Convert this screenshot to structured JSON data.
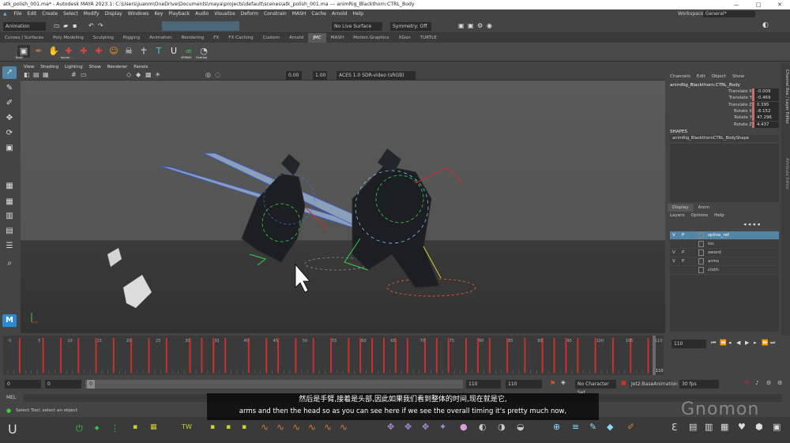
{
  "title_bar": {
    "text": "atk_polish_001.ma* - Autodesk MAYA 2023.1: C:\\Users\\juanm\\OneDrive\\Documents\\maya\\projects\\default\\scenes\\atk_polish_001.ma  ---  animRig_Blackthorn:CTRL_Body",
    "minimize": "—",
    "maximize": "□",
    "close": "✕"
  },
  "menu_bar": {
    "items": [
      "File",
      "Edit",
      "Create",
      "Select",
      "Modify",
      "Display",
      "Windows",
      "Key",
      "Playback",
      "Audio",
      "Visualize",
      "Deform",
      "Constrain",
      "MASH",
      "Cache",
      "Arnold",
      "Help"
    ],
    "workspace_label": "Workspace:",
    "workspace_value": "General*"
  },
  "status_line": {
    "menu_set": "Animation",
    "live_surface": "No Live Surface",
    "symmetry": "Symmetry: Off"
  },
  "shelf_tabs": [
    "Curves / Surfaces",
    "Poly Modeling",
    "Sculpting",
    "Rigging",
    "Animation",
    "Rendering",
    "FX",
    "FX Caching",
    "Custom",
    "Arnold",
    "JMC",
    "MASH",
    "Motion Graphics",
    "XGen",
    "TURTLE"
  ],
  "shelf_tab_active": "JMC",
  "shelf_icons": [
    {
      "icon": "bake-icon",
      "label": "BAKE",
      "color": "#333"
    },
    {
      "icon": "feather-icon",
      "label": "",
      "color": "#4a4a4a"
    },
    {
      "icon": "hand-icon",
      "label": "",
      "color": "#4a4a4a"
    },
    {
      "icon": "red-character-icon",
      "label": "bonier",
      "color": "#4a4a4a"
    },
    {
      "icon": "red-character-icon-2",
      "label": "",
      "color": "#4a4a4a"
    },
    {
      "icon": "red-character-icon-3",
      "label": "",
      "color": "#4a4a4a"
    },
    {
      "icon": "smiley-icon",
      "label": "",
      "color": "#4a4a4a"
    },
    {
      "icon": "skull-icon",
      "label": "",
      "color": "#4a4a4a"
    },
    {
      "icon": "stick-figure-icon",
      "label": "",
      "color": "#4a4a4a"
    },
    {
      "icon": "t-pose-icon",
      "label": "",
      "color": "#4a4a4a"
    },
    {
      "icon": "magnet-icon",
      "label": "",
      "color": "#4a4a4a"
    },
    {
      "icon": "spring-icon",
      "label": "SPRING",
      "color": "#4a4a4a"
    },
    {
      "icon": "overlap-icon",
      "label": "Overlap",
      "color": "#4a4a4a"
    }
  ],
  "viewport": {
    "menus": [
      "View",
      "Shading",
      "Lighting",
      "Show",
      "Renderer",
      "Panels"
    ],
    "exposure": "0.00",
    "gamma": "1.00",
    "color_space": "ACES 1.0 SDR-video (sRGB)"
  },
  "channel_box": {
    "tabs": [
      "Channels",
      "Edit",
      "Object",
      "Show"
    ],
    "node_name": "animRig_Blackthorn:CTRL_Body",
    "attributes": [
      {
        "label": "Translate X",
        "value": "-0.009"
      },
      {
        "label": "Translate Y",
        "value": "-0.469"
      },
      {
        "label": "Translate Z",
        "value": "0.395"
      },
      {
        "label": "Rotate X",
        "value": "-6.152"
      },
      {
        "label": "Rotate Y",
        "value": "47.296"
      },
      {
        "label": "Rotate Z",
        "value": "4.437"
      }
    ],
    "shapes_header": "SHAPES",
    "shape_name": "animRig_BlackthornCTRL_BodyShape"
  },
  "layer_editor": {
    "tabs": [
      "Display",
      "Anim"
    ],
    "menus": [
      "Layers",
      "Options",
      "Help"
    ],
    "layers": [
      {
        "v": "V",
        "p": "P",
        "name": "spline_ref",
        "selected": true
      },
      {
        "v": "",
        "p": "",
        "name": "loc",
        "selected": false
      },
      {
        "v": "V",
        "p": "P",
        "name": "sword",
        "selected": false
      },
      {
        "v": "V",
        "p": "P",
        "name": "arms",
        "selected": false
      },
      {
        "v": "",
        "p": "",
        "name": "cloth",
        "selected": false
      }
    ]
  },
  "side_tabs": [
    "Channel Box / Layer Editor",
    "Attribute Editor"
  ],
  "time_slider": {
    "ticks": [
      "0",
      "5",
      "10",
      "15",
      "20",
      "25",
      "30",
      "35",
      "40",
      "45",
      "50",
      "55",
      "60",
      "65",
      "70",
      "75",
      "80",
      "85",
      "90",
      "95",
      "100",
      "105",
      "110"
    ],
    "current_frame": "110",
    "end_marker": "110",
    "keyframes": [
      2,
      6,
      9,
      12,
      15,
      18,
      21,
      24,
      27,
      31,
      33,
      35,
      37,
      41,
      44,
      46,
      49,
      52,
      55,
      58,
      60,
      62,
      64,
      66,
      68,
      71,
      73,
      75,
      78,
      80,
      82,
      85,
      88,
      91,
      93,
      95,
      97,
      100,
      103,
      106,
      109
    ]
  },
  "range_bar": {
    "start": "0",
    "anim_start": "0",
    "range_label": "0",
    "range_end": "110",
    "anim_end": "110",
    "char_set": "No Character Set",
    "anim_layer": "Jet2:BaseAnimation",
    "fps": "30 fps"
  },
  "mel_label": "MEL",
  "help_line": "Select Tool: select an object",
  "subtitles": {
    "line1": "然后是手臂,接着是头部,因此如果我们看到整体的时间,现在就是它,",
    "line2": "arms and then the head so as you can see here if we see the overall timing it's pretty much now,"
  },
  "watermark": "Gnomon",
  "colors": {
    "keyframe": "#c8322a",
    "selection": "#5285a6",
    "channel_highlight": "#c76b6b"
  }
}
